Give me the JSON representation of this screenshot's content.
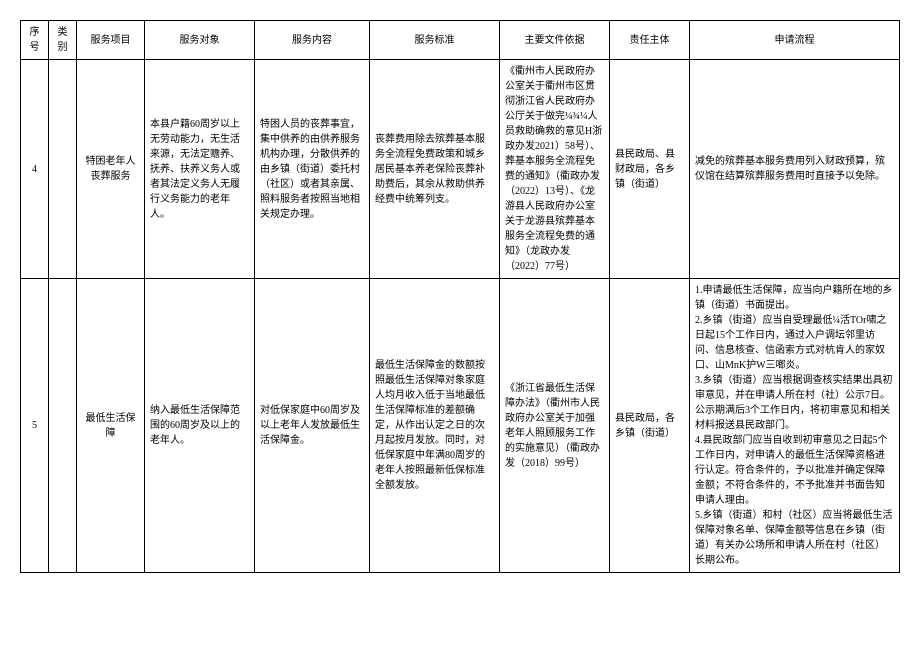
{
  "headers": {
    "seq": "序号",
    "category": "类别",
    "project": "服务项目",
    "object": "服务对象",
    "content": "服务内容",
    "standard": "服务标准",
    "basis": "主要文件依据",
    "responsible": "责任主体",
    "process": "申请流程"
  },
  "rows": [
    {
      "seq": "4",
      "category": "",
      "project": "特困老年人丧葬服务",
      "object": "本县户籍60周岁以上无劳动能力，无生活来源，无法定赡养、抚养、扶养义务人或者其法定义务人无履行义务能力的老年人。",
      "content": "特困人员的丧葬事宜，集中供养的由供养服务机构办理，分散供养的由乡镇（街道）委托村（社区）或者其亲属、照料服务者按照当地相关规定办理。",
      "standard": "丧葬费用除去殡葬基本服务全流程免费政策和城乡居民基本养老保险丧葬补助费后，其余从救助供养经费中统筹列支。",
      "basis": "《衢州市人民政府办公室关于衢州市区贯彻浙江省人民政府办公厅关于做完¼¾¼人员救助确救的意见H浙政办发2021）58号）、葬基本服务全流程免费的通知》（衢政办发（2022）13号）、《龙游县人民政府办公室关于龙游县殡葬基本服务全流程免费的通知》（龙政办发（2022）77号）",
      "responsible": "县民政局、县财政局，各乡镇（街道）",
      "process": "减免的殡葬基本服务费用列入财政预算，殡仪馆在结算殡葬服务费用时直接予以免除。"
    },
    {
      "seq": "5",
      "category": "",
      "project": "最低生活保障",
      "object": "纳入最低生活保障范围的60周岁及以上的老年人。",
      "content": "对低保家庭中60周岁及以上老年人发放最低生活保障金。",
      "standard": "最低生活保障金的数额按照最低生活保障对象家庭人均月收入低于当地最低生活保障标准的差额确定，从作出认定之日的次月起按月发放。同时，对低保家庭中年满80周岁的老年人按照最新低保标准全额发放。",
      "basis": "《浙江省最低生活保障办法》（衢州市人民政府办公室关于加强老年人照顾服务工作的实施意见）（衢政办发（2018）99号）",
      "responsible": "县民政局，各乡镇（街道）",
      "process": "1.申请最低生活保障，应当向户籍所在地的乡镇（街道）书面提出。\n2.乡镇（街道）应当自受理最低¼活TOr啸之日起15个工作日内，通过入户调坛邻里访问、信息核查、信函索方式对杭肯人的家奴口、山MnK护W三啷炎。\n3.乡镇（街道）应当根据调查核实结果出具初审意见，并在申请人所在村（社）公示7日。公示期满后3个工作日内，将初审意见和相关材料报送县民政部门。\n4.县民政部门应当自收到初审意见之日起5个工作日内，对申请人的最低生活保障资格进行认定。符合条件的，予以批准并确定保障金额；不符合条件的，不予批准并书面告知申请人理由。\n5.乡镇（街道）和村（社区）应当将最低生活保障对象名单、保障金额等信息在乡镇（街道）有关办公场所和申请人所在村（社区）长期公布。"
    }
  ]
}
